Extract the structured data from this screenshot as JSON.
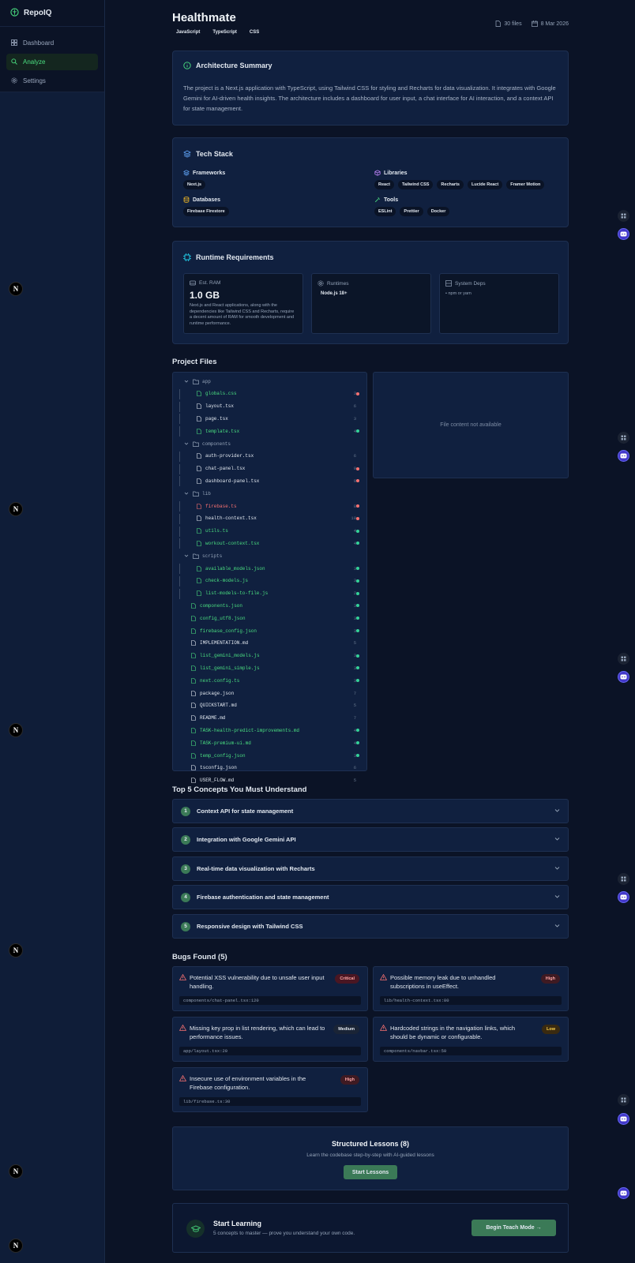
{
  "sidebar": {
    "brand": "RepoIQ",
    "items": [
      {
        "label": "Dashboard",
        "icon": "grid-icon"
      },
      {
        "label": "Analyze",
        "icon": "search-icon",
        "active": true
      },
      {
        "label": "Settings",
        "icon": "gear-icon"
      }
    ],
    "n_badge": "N"
  },
  "header": {
    "title": "Healthmate",
    "languages": [
      "JavaScript",
      "TypeScript",
      "CSS"
    ],
    "files": "30 files",
    "date": "8 Mar 2026"
  },
  "architecture": {
    "title": "Architecture Summary",
    "text": "The project is a Next.js application with TypeScript, using Tailwind CSS for styling and Recharts for data visualization. It integrates with Google Gemini for AI-driven health insights. The architecture includes a dashboard for user input, a chat interface for AI interaction, and a context API for state management."
  },
  "tech_stack": {
    "title": "Tech Stack",
    "frameworks": {
      "label": "Frameworks",
      "items": [
        "Next.js"
      ]
    },
    "libraries": {
      "label": "Libraries",
      "items": [
        "React",
        "Tailwind CSS",
        "Recharts",
        "Lucide React",
        "Framer Motion"
      ]
    },
    "databases": {
      "label": "Databases",
      "items": [
        "Firebase Firestore"
      ]
    },
    "tools": {
      "label": "Tools",
      "items": [
        "ESLint",
        "Prettier",
        "Docker"
      ]
    }
  },
  "runtime": {
    "title": "Runtime Requirements",
    "ram_label": "Est. RAM",
    "ram_value": "1.0 GB",
    "ram_desc": "Next.js and React applications, along with the dependencies like Tailwind CSS and Recharts, require a decent amount of RAM for smooth development and runtime performance.",
    "runtimes_label": "Runtimes",
    "runtimes_chip": "Node.js 18+",
    "deps_label": "System Deps",
    "deps_value": "• npm or yarn"
  },
  "project_files": {
    "title": "Project Files",
    "preview_empty": "File content not available",
    "rows": [
      {
        "name": "app",
        "type": "folder",
        "depth": 0
      },
      {
        "name": "globals.css",
        "type": "file",
        "depth": 1,
        "color": "green",
        "count": "3",
        "dot": "red"
      },
      {
        "name": "layout.tsx",
        "type": "file",
        "depth": 1,
        "color": "white",
        "count": "6"
      },
      {
        "name": "page.tsx",
        "type": "file",
        "depth": 1,
        "color": "white",
        "count": "3"
      },
      {
        "name": "template.tsx",
        "type": "file",
        "depth": 1,
        "color": "green",
        "count": "4",
        "dot": "green"
      },
      {
        "name": "components",
        "type": "folder",
        "depth": 0
      },
      {
        "name": "auth-provider.tsx",
        "type": "file",
        "depth": 1,
        "color": "white",
        "count": "6"
      },
      {
        "name": "chat-panel.tsx",
        "type": "file",
        "depth": 1,
        "color": "white",
        "count": "9",
        "dot": "red"
      },
      {
        "name": "dashboard-panel.tsx",
        "type": "file",
        "depth": 1,
        "color": "white",
        "count": "9",
        "dot": "red"
      },
      {
        "name": "lib",
        "type": "folder",
        "depth": 0
      },
      {
        "name": "firebase.ts",
        "type": "file",
        "depth": 1,
        "color": "red",
        "count": "8",
        "dot": "red"
      },
      {
        "name": "health-context.tsx",
        "type": "file",
        "depth": 1,
        "color": "white",
        "count": "10",
        "dot": "red"
      },
      {
        "name": "utils.ts",
        "type": "file",
        "depth": 1,
        "color": "green",
        "count": "4",
        "dot": "green"
      },
      {
        "name": "workout-context.tsx",
        "type": "file",
        "depth": 1,
        "color": "green",
        "count": "4",
        "dot": "green"
      },
      {
        "name": "scripts",
        "type": "folder",
        "depth": 0
      },
      {
        "name": "available_models.json",
        "type": "file",
        "depth": 1,
        "color": "green",
        "count": "3",
        "dot": "green"
      },
      {
        "name": "check-models.js",
        "type": "file",
        "depth": 1,
        "color": "green",
        "count": "3",
        "dot": "green"
      },
      {
        "name": "list-models-to-file.js",
        "type": "file",
        "depth": 1,
        "color": "green",
        "count": "2",
        "dot": "green"
      },
      {
        "name": "components.json",
        "type": "file",
        "depth": 0,
        "color": "green",
        "count": "3",
        "dot": "green"
      },
      {
        "name": "config_utf8.json",
        "type": "file",
        "depth": 0,
        "color": "green",
        "count": "3",
        "dot": "green"
      },
      {
        "name": "firebase_config.json",
        "type": "file",
        "depth": 0,
        "color": "green",
        "count": "3",
        "dot": "green"
      },
      {
        "name": "IMPLEMENTATION.md",
        "type": "file",
        "depth": 0,
        "color": "white",
        "count": "5"
      },
      {
        "name": "list_gemini_models.js",
        "type": "file",
        "depth": 0,
        "color": "green",
        "count": "3",
        "dot": "green"
      },
      {
        "name": "list_gemini_simple.js",
        "type": "file",
        "depth": 0,
        "color": "green",
        "count": "3",
        "dot": "green"
      },
      {
        "name": "next.config.ts",
        "type": "file",
        "depth": 0,
        "color": "green",
        "count": "3",
        "dot": "green"
      },
      {
        "name": "package.json",
        "type": "file",
        "depth": 0,
        "color": "white",
        "count": "7"
      },
      {
        "name": "QUICKSTART.md",
        "type": "file",
        "depth": 0,
        "color": "white",
        "count": "5"
      },
      {
        "name": "README.md",
        "type": "file",
        "depth": 0,
        "color": "white",
        "count": "7"
      },
      {
        "name": "TASK-health-predict-improvements.md",
        "type": "file",
        "depth": 0,
        "color": "green",
        "count": "4",
        "dot": "green"
      },
      {
        "name": "TASK-premium-ui.md",
        "type": "file",
        "depth": 0,
        "color": "green",
        "count": "4",
        "dot": "green"
      },
      {
        "name": "temp_config.json",
        "type": "file",
        "depth": 0,
        "color": "green",
        "count": "3",
        "dot": "green"
      },
      {
        "name": "tsconfig.json",
        "type": "file",
        "depth": 0,
        "color": "white",
        "count": "6"
      },
      {
        "name": "USER_FLOW.md",
        "type": "file",
        "depth": 0,
        "color": "white",
        "count": "5"
      }
    ]
  },
  "concepts": {
    "title": "Top 5 Concepts You Must Understand",
    "items": [
      {
        "num": "1",
        "label": "Context API for state management"
      },
      {
        "num": "2",
        "label": "Integration with Google Gemini API"
      },
      {
        "num": "3",
        "label": "Real-time data visualization with Recharts"
      },
      {
        "num": "4",
        "label": "Firebase authentication and state management"
      },
      {
        "num": "5",
        "label": "Responsive design with Tailwind CSS"
      }
    ]
  },
  "bugs": {
    "title": "Bugs Found (5)",
    "items": [
      {
        "text": "Potential XSS vulnerability due to unsafe user input handling.",
        "severity": "Critical",
        "location": "components/chat-panel.tsx:120"
      },
      {
        "text": "Possible memory leak due to unhandled subscriptions in useEffect.",
        "severity": "High",
        "location": "lib/health-context.tsx:80"
      },
      {
        "text": "Missing key prop in list rendering, which can lead to performance issues.",
        "severity": "Medium",
        "location": "app/layout.tsx:20"
      },
      {
        "text": "Hardcoded strings in the navigation links, which should be dynamic or configurable.",
        "severity": "Low",
        "location": "components/navbar.tsx:50"
      },
      {
        "text": "Insecure use of environment variables in the Firebase configuration.",
        "severity": "High",
        "location": "lib/firebase.ts:30"
      }
    ]
  },
  "lessons": {
    "title": "Structured Lessons (8)",
    "subtitle": "Learn the codebase step-by-step with AI-guided lessons",
    "button": "Start Lessons"
  },
  "learning": {
    "title": "Start Learning",
    "subtitle": "5 concepts to master — prove you understand your own code.",
    "button": "Begin Teach Mode →"
  },
  "colors": {
    "accent": "#3b7a57",
    "green_text": "#4ade80",
    "red_text": "#f87171",
    "background": "#0b1326",
    "card": "#10203f"
  }
}
